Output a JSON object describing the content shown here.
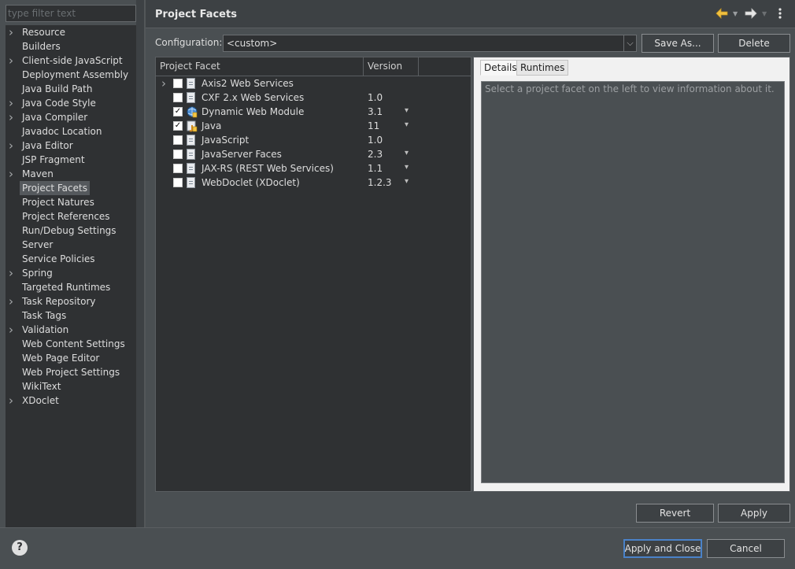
{
  "filter": {
    "placeholder": "type filter text"
  },
  "nav": [
    {
      "label": "Resource",
      "expandable": true
    },
    {
      "label": "Builders",
      "expandable": false
    },
    {
      "label": "Client-side JavaScript",
      "expandable": true
    },
    {
      "label": "Deployment Assembly",
      "expandable": false
    },
    {
      "label": "Java Build Path",
      "expandable": false
    },
    {
      "label": "Java Code Style",
      "expandable": true
    },
    {
      "label": "Java Compiler",
      "expandable": true
    },
    {
      "label": "Javadoc Location",
      "expandable": false
    },
    {
      "label": "Java Editor",
      "expandable": true
    },
    {
      "label": "JSP Fragment",
      "expandable": false
    },
    {
      "label": "Maven",
      "expandable": true
    },
    {
      "label": "Project Facets",
      "expandable": false,
      "selected": true
    },
    {
      "label": "Project Natures",
      "expandable": false
    },
    {
      "label": "Project References",
      "expandable": false
    },
    {
      "label": "Run/Debug Settings",
      "expandable": false
    },
    {
      "label": "Server",
      "expandable": false
    },
    {
      "label": "Service Policies",
      "expandable": false
    },
    {
      "label": "Spring",
      "expandable": true
    },
    {
      "label": "Targeted Runtimes",
      "expandable": false
    },
    {
      "label": "Task Repository",
      "expandable": true
    },
    {
      "label": "Task Tags",
      "expandable": false
    },
    {
      "label": "Validation",
      "expandable": true
    },
    {
      "label": "Web Content Settings",
      "expandable": false
    },
    {
      "label": "Web Page Editor",
      "expandable": false
    },
    {
      "label": "Web Project Settings",
      "expandable": false
    },
    {
      "label": "WikiText",
      "expandable": false
    },
    {
      "label": "XDoclet",
      "expandable": true
    }
  ],
  "page": {
    "title": "Project Facets"
  },
  "config": {
    "label": "Configuration:",
    "value": "<custom>",
    "save_as": "Save As...",
    "delete": "Delete"
  },
  "table": {
    "col_facet": "Project Facet",
    "col_version": "Version",
    "rows": [
      {
        "name": "Axis2 Web Services",
        "version": "",
        "checked": false,
        "expandable": true,
        "dropdown": false,
        "icon": "document-icon"
      },
      {
        "name": "CXF 2.x Web Services",
        "version": "1.0",
        "checked": false,
        "expandable": false,
        "dropdown": false,
        "icon": "document-icon"
      },
      {
        "name": "Dynamic Web Module",
        "version": "3.1",
        "checked": true,
        "expandable": false,
        "dropdown": true,
        "icon": "web-module-icon"
      },
      {
        "name": "Java",
        "version": "11",
        "checked": true,
        "expandable": false,
        "dropdown": true,
        "icon": "java-icon"
      },
      {
        "name": "JavaScript",
        "version": "1.0",
        "checked": false,
        "expandable": false,
        "dropdown": false,
        "icon": "document-icon"
      },
      {
        "name": "JavaServer Faces",
        "version": "2.3",
        "checked": false,
        "expandable": false,
        "dropdown": true,
        "icon": "document-icon"
      },
      {
        "name": "JAX-RS (REST Web Services)",
        "version": "1.1",
        "checked": false,
        "expandable": false,
        "dropdown": true,
        "icon": "document-icon"
      },
      {
        "name": "WebDoclet (XDoclet)",
        "version": "1.2.3",
        "checked": false,
        "expandable": false,
        "dropdown": true,
        "icon": "document-icon"
      }
    ]
  },
  "details": {
    "tab_details": "Details",
    "tab_runtimes": "Runtimes",
    "text": "Select a project facet on the left to view information about it."
  },
  "buttons": {
    "revert": "Revert",
    "apply": "Apply",
    "apply_and_close": "Apply and Close",
    "cancel": "Cancel"
  },
  "icons": {
    "back": "back-arrow-icon",
    "forward": "forward-arrow-icon",
    "menu": "view-menu-icon",
    "help": "help-icon"
  },
  "colors": {
    "background": "#2f3133",
    "panel": "#4a4f52",
    "back_arrow": "#f0c040",
    "accent": "#4a82c8"
  }
}
